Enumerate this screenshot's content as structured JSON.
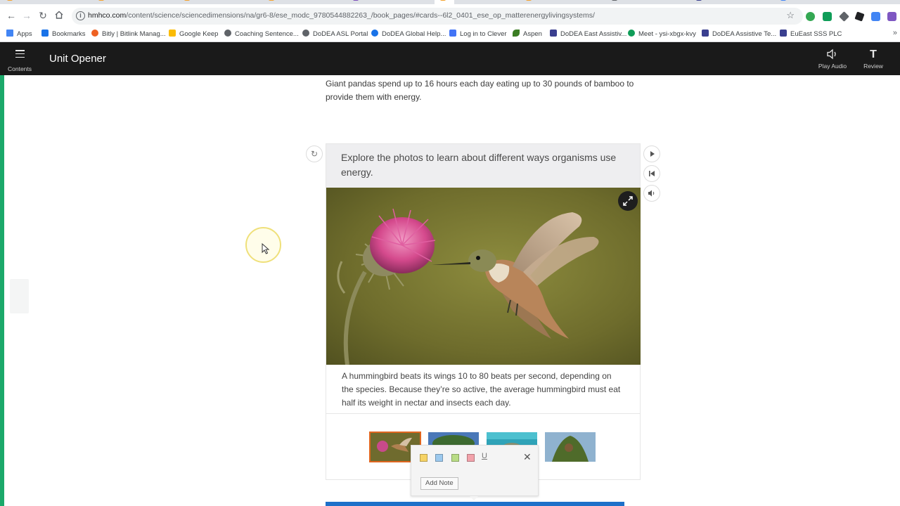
{
  "browser": {
    "url_host": "hmhco.com",
    "url_path": "/content/science/sciencedimensions/na/gr6-8/ese_modc_9780544882263_/book_pages/#cards--6l2_0401_ese_op_matterenergylivingsystems/",
    "bookmarks": [
      {
        "label": "Apps",
        "icon": "apps-grid-icon",
        "color": "#4285f4"
      },
      {
        "label": "Bookmarks",
        "icon": "star-icon",
        "color": "#1a73e8"
      },
      {
        "label": "Bitly | Bitlink Manag...",
        "icon": "bitly-icon",
        "color": "#ee6123"
      },
      {
        "label": "Google Keep",
        "icon": "keep-icon",
        "color": "#fbbc04"
      },
      {
        "label": "Coaching Sentence...",
        "icon": "globe-icon",
        "color": "#5f6368"
      },
      {
        "label": "DoDEA ASL Portal",
        "icon": "globe-icon",
        "color": "#5f6368"
      },
      {
        "label": "DoDEA Global Help...",
        "icon": "dodea-icon",
        "color": "#1a73e8"
      },
      {
        "label": "Log in to Clever",
        "icon": "clever-icon",
        "color": "#4274f6"
      },
      {
        "label": "Aspen",
        "icon": "aspen-leaf-icon",
        "color": "#3b7d23"
      },
      {
        "label": "DoDEA East Assistiv...",
        "icon": "doc-icon",
        "color": "#3a3f8f"
      },
      {
        "label": "Meet - ysi-xbgx-kvy",
        "icon": "meet-icon",
        "color": "#0f9d58"
      },
      {
        "label": "DoDEA Assistive Te...",
        "icon": "doc-icon",
        "color": "#3a3f8f"
      },
      {
        "label": "EuEast SSS PLC",
        "icon": "doc-icon",
        "color": "#3a3f8f"
      }
    ]
  },
  "app": {
    "contents_label": "Contents",
    "title": "Unit Opener",
    "play_audio_label": "Play Audio",
    "review_label": "Review",
    "review_glyph": "T"
  },
  "intro_text": "Giant pandas spend up to 16 hours each day eating up to 30 pounds of bamboo to provide them with energy.",
  "card": {
    "prompt": "Explore the photos to learn about different ways organisms use energy.",
    "caption": "A hummingbird beats its wings 10 to 80 beats per second, depending on the species. Because they’re so active, the average hummingbird must eat half its weight in nectar and insects each day.",
    "thumbnails": [
      {
        "name": "hummingbird-thumbnail",
        "selected": true
      },
      {
        "name": "tree-thumbnail",
        "selected": false
      },
      {
        "name": "water-thumbnail",
        "selected": false
      },
      {
        "name": "plant-thumbnail",
        "selected": false
      }
    ]
  },
  "note_popup": {
    "colors": [
      "#f6d365",
      "#9cc9ee",
      "#b9dc85",
      "#f2a2aa"
    ],
    "underline_label": "U",
    "add_note_label": "Add Note"
  },
  "colors": {
    "accent_green": "#1ba96a",
    "header_bg": "#1a1a1a",
    "selected_thumb": "#e0661f",
    "bottom_bar": "#1d70c9"
  }
}
